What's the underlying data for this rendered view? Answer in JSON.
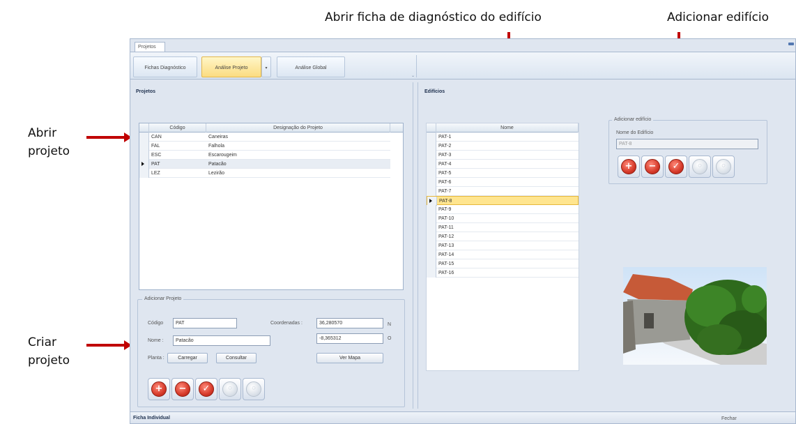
{
  "annotations": {
    "abrir_ficha": "Abrir ficha de diagnóstico do edifício",
    "adicionar_edificio": "Adicionar edifício",
    "abrir_projeto": [
      "Abrir",
      "projeto"
    ],
    "criar_projeto": [
      "Criar",
      "projeto"
    ]
  },
  "window": {
    "doc_tab": "Projetos"
  },
  "ribbon": {
    "tabs": [
      "Fichas Diagnóstico",
      "Análise Projeto",
      "Análise Global"
    ],
    "active_tab": "Análise Projeto",
    "dropdown_glyph": "▾"
  },
  "projetos": {
    "title": "Projetos",
    "columns": [
      "Código",
      "Designação do Projeto"
    ],
    "rows": [
      {
        "codigo": "CAN",
        "designacao": "Caneiras"
      },
      {
        "codigo": "FAL",
        "designacao": "Falhola"
      },
      {
        "codigo": "ESC",
        "designacao": "Escarougeim"
      },
      {
        "codigo": "PAT",
        "designacao": "Patacão"
      },
      {
        "codigo": "LEZ",
        "designacao": "Lezirão"
      }
    ],
    "selected_index": 3
  },
  "adicionar_projeto": {
    "title": "Adicionar Projeto",
    "codigo_label": "Código",
    "codigo_value": "PAT",
    "nome_label": "Nome :",
    "nome_value": "Patacão",
    "planta_label": "Planta :",
    "carregar_btn": "Carregar",
    "consultar_btn": "Consultar",
    "coordenadas_label": "Coordenadas :",
    "lat_value": "36,280570",
    "lon_value": "-8,365312",
    "lat_dir": "N",
    "lon_dir": "O",
    "ver_mapa_btn": "Ver Mapa"
  },
  "edificios": {
    "title": "Edifícios",
    "column": "Nome",
    "rows": [
      "PAT-1",
      "PAT-2",
      "PAT-3",
      "PAT-4",
      "PAT-5",
      "PAT-6",
      "PAT-7",
      "PAT-8",
      "PAT-9",
      "PAT-10",
      "PAT-11",
      "PAT-12",
      "PAT-13",
      "PAT-14",
      "PAT-15",
      "PAT-16"
    ],
    "selected_index": 7
  },
  "adicionar_edificio": {
    "title": "Adicionar edifício",
    "nome_label": "Nome do Edifício",
    "nome_value": "PAT-8"
  },
  "buttons": {
    "add_glyph": "+",
    "remove_glyph": "−",
    "edit_glyph": "✓",
    "disabled_glyph": "◦"
  },
  "footer": {
    "left": "Ficha Individual",
    "right": "Fechar"
  },
  "colors": {
    "arrow": "#c00000",
    "ribbon_active": "#fbdc81",
    "row_highlight": "#ffe58f"
  }
}
